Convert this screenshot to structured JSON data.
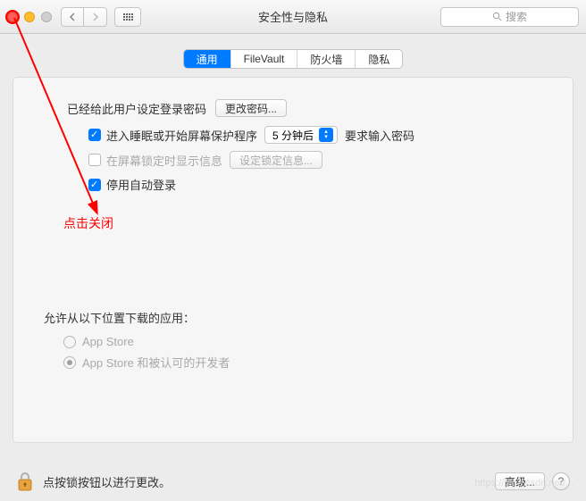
{
  "window": {
    "title": "安全性与隐私",
    "search_placeholder": "搜索"
  },
  "tabs": [
    {
      "id": "general",
      "label": "通用",
      "active": true
    },
    {
      "id": "filevault",
      "label": "FileVault",
      "active": false
    },
    {
      "id": "firewall",
      "label": "防火墙",
      "active": false
    },
    {
      "id": "privacy",
      "label": "隐私",
      "active": false
    }
  ],
  "general": {
    "password_set_label": "已经给此用户设定登录密码",
    "change_password_btn": "更改密码...",
    "sleep_lock": {
      "checked": true,
      "label_before": "进入睡眠或开始屏幕保护程序",
      "select_value": "5 分钟后",
      "label_after": "要求输入密码"
    },
    "show_message": {
      "checked": false,
      "label": "在屏幕锁定时显示信息",
      "set_message_btn": "设定锁定信息..."
    },
    "disable_autologin": {
      "checked": true,
      "label": "停用自动登录"
    },
    "allow_apps_label": "允许从以下位置下载的应用：",
    "radio_options": [
      {
        "id": "appstore",
        "label": "App Store",
        "selected": false
      },
      {
        "id": "identified",
        "label": "App Store 和被认可的开发者",
        "selected": true
      }
    ]
  },
  "annotation": "点击关闭",
  "footer": {
    "lock_text": "点按锁按钮以进行更改。",
    "advanced_btn": "高级...",
    "help": "?"
  },
  "watermark": "https://blog.csdn.net/..."
}
